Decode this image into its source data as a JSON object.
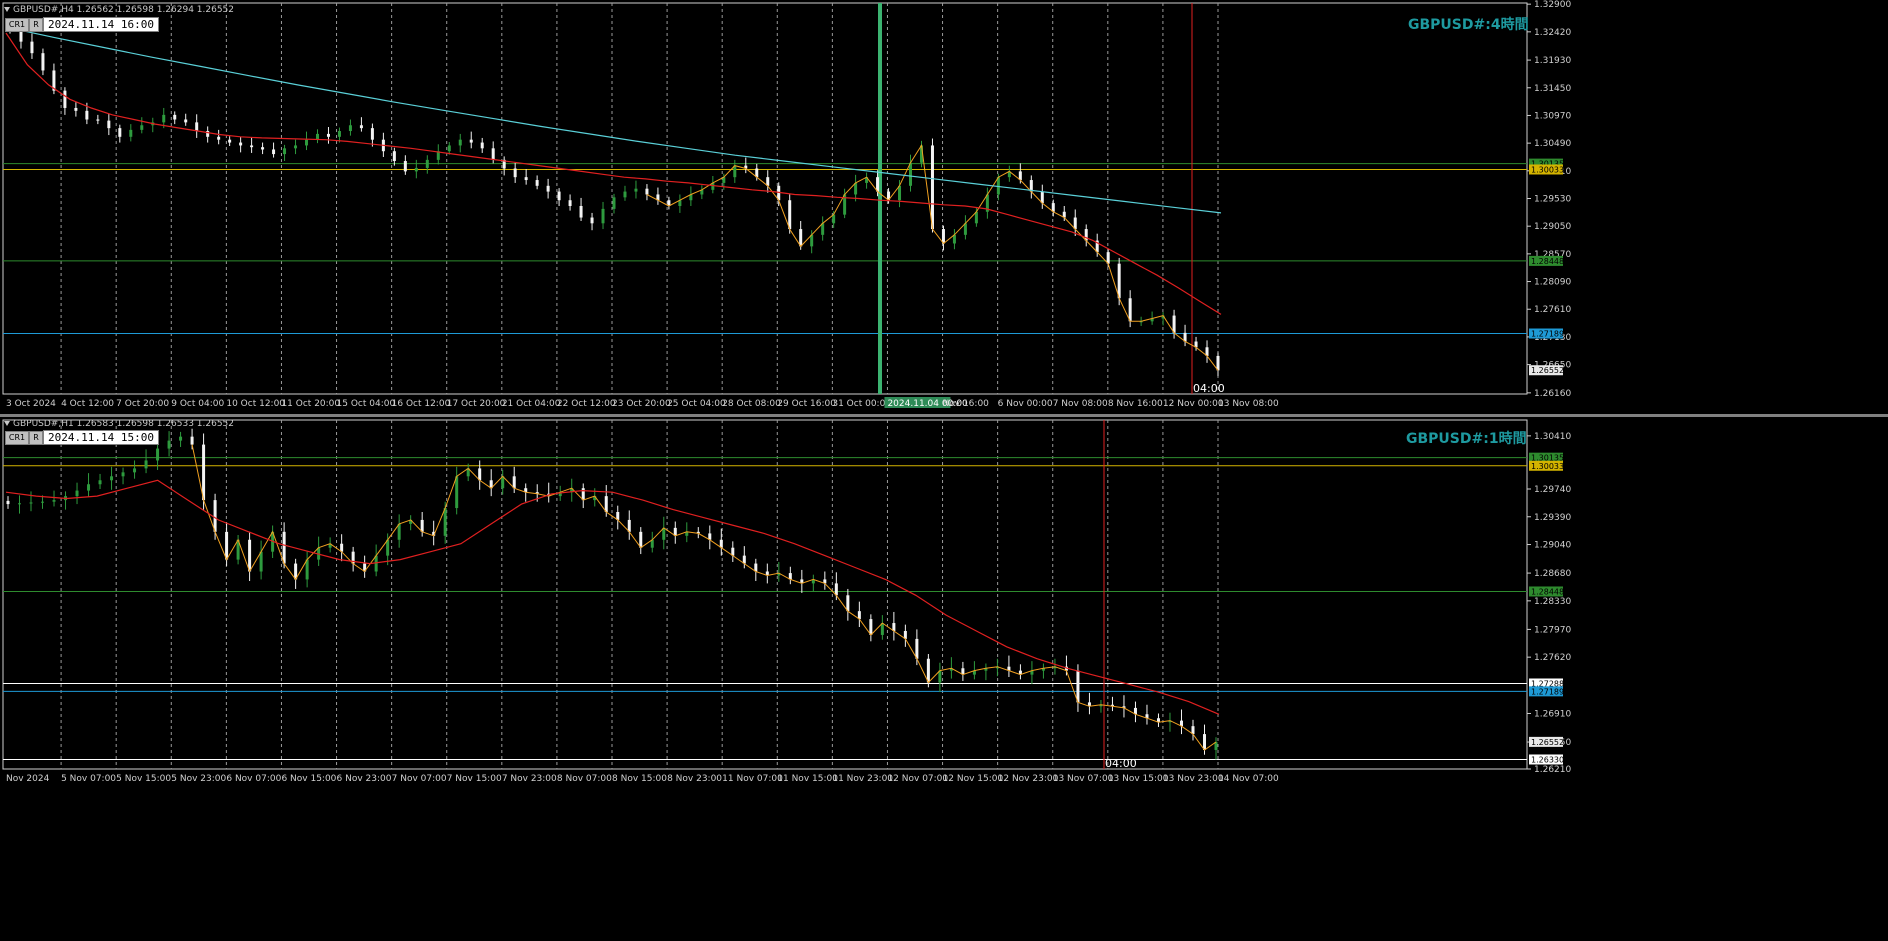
{
  "chart_data": [
    {
      "type": "candlestick",
      "symbol": "GBPUSD#",
      "timeframe": "H4",
      "header": "GBPUSD#,H4  1.26562 1.26598 1.26294 1.26552",
      "title": "GBPUSD#:4時間",
      "date_box": "2024.11.14 16:00",
      "buttons": [
        "CR1",
        "R"
      ],
      "ylim": [
        1.2614,
        1.3292
      ],
      "y_ticks": [
        "1.32900",
        "1.32420",
        "1.31930",
        "1.31450",
        "1.30970",
        "1.30490",
        "1.30010",
        "1.29530",
        "1.29050",
        "1.28570",
        "1.28090",
        "1.27610",
        "1.27130",
        "1.26650",
        "1.26160"
      ],
      "x_ticks": [
        "3 Oct 2024",
        "4 Oct 12:00",
        "7 Oct 20:00",
        "9 Oct 04:00",
        "10 Oct 12:00",
        "11 Oct 20:00",
        "15 Oct 04:00",
        "16 Oct 12:00",
        "17 Oct 20:00",
        "21 Oct 04:00",
        "22 Oct 12:00",
        "23 Oct 20:00",
        "25 Oct 04:00",
        "28 Oct 08:00",
        "29 Oct 16:00",
        "31 Oct 00:00",
        "2024.11.04 00:00",
        "Nov 16:00",
        "6 Nov 00:00",
        "7 Nov 08:00",
        "8 Nov 16:00",
        "12 Nov 00:00",
        "13 Nov 08:00"
      ],
      "time_label": "04:00",
      "price_lines": [
        {
          "label": "1.30135",
          "value": 1.30135,
          "color": "#2e8b2e"
        },
        {
          "label": "1.30033",
          "value": 1.30033,
          "color": "#d4b400"
        },
        {
          "label": "1.28448",
          "value": 1.28448,
          "color": "#2e8b2e"
        },
        {
          "label": "1.27189",
          "value": 1.27189,
          "color": "#1e9ad6"
        }
      ],
      "last_price": "1.26552",
      "series": [
        {
          "kind": "ohlc",
          "close": [
            1.3245,
            1.3225,
            1.3205,
            1.3175,
            1.314,
            1.311,
            1.3105,
            1.309,
            1.3088,
            1.3075,
            1.306,
            1.3072,
            1.308,
            1.3085,
            1.3098,
            1.309,
            1.3085,
            1.307,
            1.306,
            1.3055,
            1.305,
            1.3045,
            1.3042,
            1.3038,
            1.303,
            1.304,
            1.3045,
            1.3055,
            1.3065,
            1.306,
            1.307,
            1.308,
            1.3075,
            1.3055,
            1.3035,
            1.3018,
            1.3,
            1.3006,
            1.302,
            1.3035,
            1.3045,
            1.3055,
            1.305,
            1.304,
            1.302,
            1.3005,
            1.299,
            1.2985,
            1.2975,
            1.2965,
            1.295,
            1.294,
            1.292,
            1.291,
            1.2935,
            1.2955,
            1.2965,
            1.297,
            1.296,
            1.295,
            1.294,
            1.295,
            1.296,
            1.2968,
            1.298,
            1.299,
            1.301,
            1.3005,
            1.299,
            1.2975,
            1.295,
            1.29,
            1.287,
            1.289,
            1.291,
            1.2925,
            1.296,
            1.298,
            1.299,
            1.2965,
            1.295,
            1.2975,
            1.3015,
            1.3045,
            1.29,
            1.2875,
            1.289,
            1.291,
            1.293,
            1.296,
            1.299,
            1.3,
            1.2985,
            1.2965,
            1.2945,
            1.293,
            1.292,
            1.29,
            1.288,
            1.286,
            1.284,
            1.278,
            1.274,
            1.274,
            1.2745,
            1.275,
            1.272,
            1.2705,
            1.2695,
            1.268,
            1.2655
          ]
        },
        {
          "name": "",
          "kind": "ma",
          "color": "#e02020",
          "values": [
            1.324,
            1.3185,
            1.315,
            1.3125,
            1.311,
            1.3098,
            1.309,
            1.3082,
            1.3076,
            1.307,
            1.3064,
            1.306,
            1.3058,
            1.3057,
            1.3056,
            1.3055,
            1.3052,
            1.3048,
            1.3044,
            1.304,
            1.3035,
            1.303,
            1.3025,
            1.302,
            1.3015,
            1.301,
            1.3005,
            1.3,
            1.2995,
            1.299,
            1.2987,
            1.2983,
            1.298,
            1.2976,
            1.2972,
            1.2968,
            1.2965,
            1.296,
            1.2958,
            1.2955,
            1.2953,
            1.295,
            1.2948,
            1.2945,
            1.2942,
            1.294,
            1.2935,
            1.2925,
            1.2915,
            1.2905,
            1.2895,
            1.288,
            1.286,
            1.284,
            1.282,
            1.2798,
            1.2775,
            1.2752
          ]
        },
        {
          "name": "",
          "kind": "ma",
          "color": "#5ad0d8",
          "values": [
            1.325,
            1.3232,
            1.3215,
            1.3198,
            1.3182,
            1.3166,
            1.315,
            1.3135,
            1.312,
            1.3106,
            1.3092,
            1.3078,
            1.3065,
            1.3052,
            1.304,
            1.3028,
            1.3018,
            1.3008,
            1.2998,
            1.2988,
            1.2978,
            1.2968,
            1.2958,
            1.2948,
            1.2938,
            1.2928
          ]
        }
      ]
    },
    {
      "type": "candlestick",
      "symbol": "GBPUSD#",
      "timeframe": "H1",
      "header": "GBPUSD#,H1  1.26583 1.26598 1.26533 1.26552",
      "title": "GBPUSD#:1時間",
      "date_box": "2024.11.14 15:00",
      "buttons": [
        "CR1",
        "R"
      ],
      "ylim": [
        1.2621,
        1.3061
      ],
      "y_ticks": [
        "1.30410",
        "1.29740",
        "1.29390",
        "1.29040",
        "1.28680",
        "1.28330",
        "1.27970",
        "1.27620",
        "1.26910",
        "1.26550",
        "1.26210"
      ],
      "x_ticks": [
        "Nov 2024",
        "5 Nov 07:00",
        "5 Nov 15:00",
        "5 Nov 23:00",
        "6 Nov 07:00",
        "6 Nov 15:00",
        "6 Nov 23:00",
        "7 Nov 07:00",
        "7 Nov 15:00",
        "7 Nov 23:00",
        "8 Nov 07:00",
        "8 Nov 15:00",
        "8 Nov 23:00",
        "11 Nov 07:00",
        "11 Nov 15:00",
        "11 Nov 23:00",
        "12 Nov 07:00",
        "12 Nov 15:00",
        "12 Nov 23:00",
        "13 Nov 07:00",
        "13 Nov 15:00",
        "13 Nov 23:00",
        "14 Nov 07:00"
      ],
      "time_label": "04:00",
      "price_lines": [
        {
          "label": "1.30135",
          "value": 1.30135,
          "color": "#2e8b2e"
        },
        {
          "label": "1.30033",
          "value": 1.30033,
          "color": "#d4b400"
        },
        {
          "label": "1.28448",
          "value": 1.28448,
          "color": "#2e8b2e"
        },
        {
          "label": "1.27288",
          "value": 1.27288,
          "color": "#ffffff"
        },
        {
          "label": "1.27189",
          "value": 1.27189,
          "color": "#1e9ad6"
        },
        {
          "label": "1.26330",
          "value": 1.2633,
          "color": "#ffffff"
        }
      ],
      "last_price": "1.26552",
      "series": [
        {
          "kind": "ohlc",
          "close": [
            1.2955,
            1.2956,
            1.2957,
            1.2958,
            1.296,
            1.2965,
            1.2972,
            1.298,
            1.2985,
            1.299,
            1.2995,
            1.3,
            1.301,
            1.3025,
            1.3035,
            1.304,
            1.303,
            1.296,
            1.292,
            1.2885,
            1.291,
            1.287,
            1.2895,
            1.292,
            1.288,
            1.286,
            1.2885,
            1.29,
            1.2905,
            1.2895,
            1.288,
            1.287,
            1.289,
            1.291,
            1.293,
            1.2935,
            1.292,
            1.2915,
            1.295,
            1.299,
            1.3,
            1.2985,
            1.2975,
            1.299,
            1.2975,
            1.297,
            1.2968,
            1.2965,
            1.297,
            1.2975,
            1.296,
            1.2965,
            1.2945,
            1.2935,
            1.292,
            1.29,
            1.291,
            1.2925,
            1.2915,
            1.292,
            1.2918,
            1.291,
            1.29,
            1.289,
            1.288,
            1.287,
            1.2865,
            1.2868,
            1.286,
            1.2855,
            1.286,
            1.2855,
            1.284,
            1.282,
            1.281,
            1.279,
            1.2805,
            1.2795,
            1.2785,
            1.276,
            1.273,
            1.2745,
            1.2748,
            1.274,
            1.2745,
            1.2748,
            1.275,
            1.2745,
            1.274,
            1.2745,
            1.2748,
            1.275,
            1.2745,
            1.2705,
            1.27,
            1.2702,
            1.27,
            1.2698,
            1.269,
            1.2685,
            1.268,
            1.2682,
            1.2675,
            1.2665,
            1.2645,
            1.2655
          ]
        },
        {
          "name": "",
          "kind": "ma",
          "color": "#e02020",
          "values": [
            1.297,
            1.2965,
            1.2962,
            1.2965,
            1.2975,
            1.2985,
            1.296,
            1.2935,
            1.292,
            1.2905,
            1.2895,
            1.2885,
            1.288,
            1.2885,
            1.2895,
            1.2905,
            1.293,
            1.2955,
            1.2968,
            1.2972,
            1.297,
            1.296,
            1.2948,
            1.2938,
            1.2928,
            1.2918,
            1.2905,
            1.289,
            1.2875,
            1.286,
            1.284,
            1.2815,
            1.2795,
            1.2775,
            1.276,
            1.2748,
            1.2738,
            1.2728,
            1.2718,
            1.2706,
            1.269
          ]
        }
      ]
    }
  ]
}
